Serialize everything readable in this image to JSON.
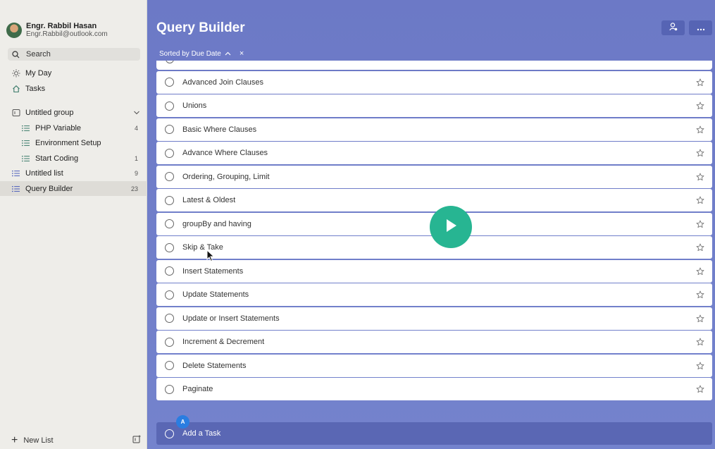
{
  "user": {
    "name": "Engr. Rabbil Hasan",
    "email": "Engr.Rabbil@outlook.com"
  },
  "search": {
    "label": "Search"
  },
  "nav": {
    "my_day": "My Day",
    "tasks": "Tasks",
    "group": {
      "label": "Untitled group"
    },
    "group_items": [
      {
        "label": "PHP Variable",
        "count": "4"
      },
      {
        "label": "Environment Setup",
        "count": ""
      },
      {
        "label": "Start Coding",
        "count": "1"
      }
    ],
    "lists": [
      {
        "label": "Untitled list",
        "count": "9"
      },
      {
        "label": "Query Builder",
        "count": "23"
      }
    ]
  },
  "new_list": "New List",
  "main": {
    "title": "Query Builder",
    "sort_label": "Sorted by Due Date",
    "sort_clear": "×",
    "add_task": "Add a Task",
    "add_badge": "A",
    "tasks": [
      "Advanced Join Clauses",
      "Unions",
      "Basic Where Clauses",
      "Advance Where Clauses",
      "Ordering, Grouping, Limit",
      "Latest & Oldest",
      "groupBy and having",
      "Skip & Take",
      "Insert Statements",
      "Update Statements",
      "Update or Insert Statements",
      "Increment & Decrement",
      "Delete Statements",
      "Paginate"
    ]
  },
  "colors": {
    "accent": "#6c79c6",
    "play": "#27b592",
    "sidebar": "#eeede9"
  }
}
